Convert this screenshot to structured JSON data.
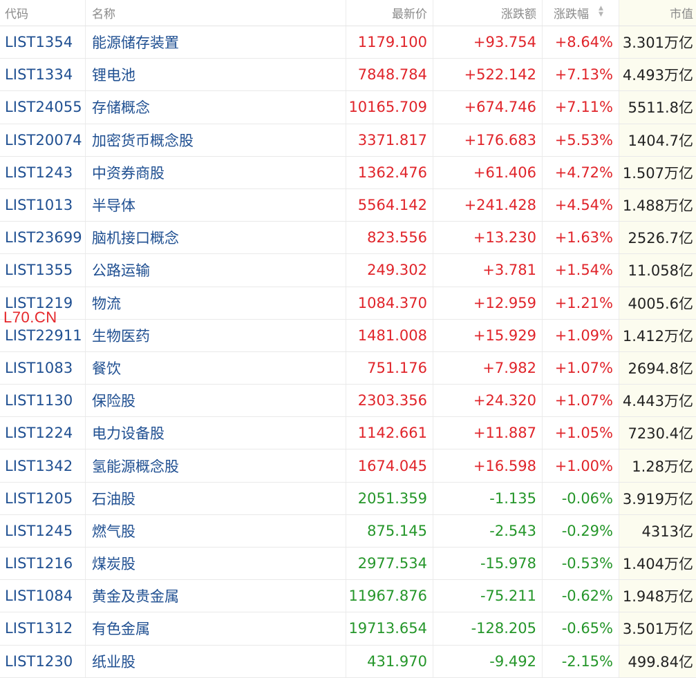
{
  "headers": {
    "code": "代码",
    "name": "名称",
    "price": "最新价",
    "change": "涨跌额",
    "pct": "涨跌幅",
    "cap": "市值"
  },
  "watermark": "L70.CN",
  "colors": {
    "up": "#e0242a",
    "down": "#25962a",
    "link": "#1f4f91",
    "cap_bg": "#fcfcef"
  },
  "rows": [
    {
      "code": "LIST1354",
      "name": "能源储存装置",
      "price": "1179.100",
      "change": "+93.754",
      "pct": "+8.64%",
      "cap": "3.301万亿",
      "dir": "up"
    },
    {
      "code": "LIST1334",
      "name": "锂电池",
      "price": "7848.784",
      "change": "+522.142",
      "pct": "+7.13%",
      "cap": "4.493万亿",
      "dir": "up"
    },
    {
      "code": "LIST24055",
      "name": "存储概念",
      "price": "10165.709",
      "change": "+674.746",
      "pct": "+7.11%",
      "cap": "5511.8亿",
      "dir": "up"
    },
    {
      "code": "LIST20074",
      "name": "加密货币概念股",
      "price": "3371.817",
      "change": "+176.683",
      "pct": "+5.53%",
      "cap": "1404.7亿",
      "dir": "up"
    },
    {
      "code": "LIST1243",
      "name": "中资券商股",
      "price": "1362.476",
      "change": "+61.406",
      "pct": "+4.72%",
      "cap": "1.507万亿",
      "dir": "up"
    },
    {
      "code": "LIST1013",
      "name": "半导体",
      "price": "5564.142",
      "change": "+241.428",
      "pct": "+4.54%",
      "cap": "1.488万亿",
      "dir": "up"
    },
    {
      "code": "LIST23699",
      "name": "脑机接口概念",
      "price": "823.556",
      "change": "+13.230",
      "pct": "+1.63%",
      "cap": "2526.7亿",
      "dir": "up"
    },
    {
      "code": "LIST1355",
      "name": "公路运输",
      "price": "249.302",
      "change": "+3.781",
      "pct": "+1.54%",
      "cap": "11.058亿",
      "dir": "up"
    },
    {
      "code": "LIST1219",
      "name": "物流",
      "price": "1084.370",
      "change": "+12.959",
      "pct": "+1.21%",
      "cap": "4005.6亿",
      "dir": "up"
    },
    {
      "code": "LIST22911",
      "name": "生物医药",
      "price": "1481.008",
      "change": "+15.929",
      "pct": "+1.09%",
      "cap": "1.412万亿",
      "dir": "up"
    },
    {
      "code": "LIST1083",
      "name": "餐饮",
      "price": "751.176",
      "change": "+7.982",
      "pct": "+1.07%",
      "cap": "2694.8亿",
      "dir": "up"
    },
    {
      "code": "LIST1130",
      "name": "保险股",
      "price": "2303.356",
      "change": "+24.320",
      "pct": "+1.07%",
      "cap": "4.443万亿",
      "dir": "up"
    },
    {
      "code": "LIST1224",
      "name": "电力设备股",
      "price": "1142.661",
      "change": "+11.887",
      "pct": "+1.05%",
      "cap": "7230.4亿",
      "dir": "up"
    },
    {
      "code": "LIST1342",
      "name": "氢能源概念股",
      "price": "1674.045",
      "change": "+16.598",
      "pct": "+1.00%",
      "cap": "1.28万亿",
      "dir": "up"
    },
    {
      "code": "LIST1205",
      "name": "石油股",
      "price": "2051.359",
      "change": "-1.135",
      "pct": "-0.06%",
      "cap": "3.919万亿",
      "dir": "down"
    },
    {
      "code": "LIST1245",
      "name": "燃气股",
      "price": "875.145",
      "change": "-2.543",
      "pct": "-0.29%",
      "cap": "4313亿",
      "dir": "down"
    },
    {
      "code": "LIST1216",
      "name": "煤炭股",
      "price": "2977.534",
      "change": "-15.978",
      "pct": "-0.53%",
      "cap": "1.404万亿",
      "dir": "down"
    },
    {
      "code": "LIST1084",
      "name": "黄金及贵金属",
      "price": "11967.876",
      "change": "-75.211",
      "pct": "-0.62%",
      "cap": "1.948万亿",
      "dir": "down"
    },
    {
      "code": "LIST1312",
      "name": "有色金属",
      "price": "19713.654",
      "change": "-128.205",
      "pct": "-0.65%",
      "cap": "3.501万亿",
      "dir": "down"
    },
    {
      "code": "LIST1230",
      "name": "纸业股",
      "price": "431.970",
      "change": "-9.492",
      "pct": "-2.15%",
      "cap": "499.84亿",
      "dir": "down"
    }
  ]
}
